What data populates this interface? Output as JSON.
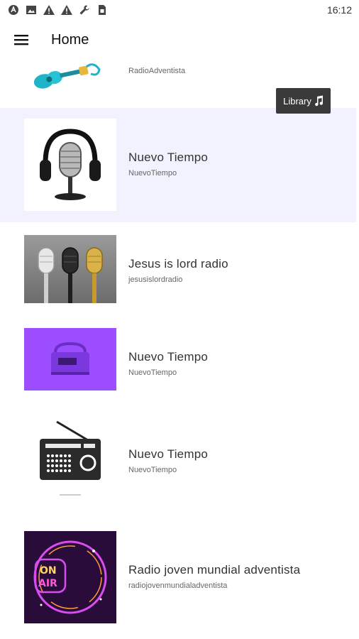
{
  "status_bar": {
    "time": "16:12",
    "icons": [
      "app-a-icon",
      "image-icon",
      "warning-icon",
      "warning-icon",
      "wrench-icon",
      "sim-icon"
    ]
  },
  "app_bar": {
    "title": "Home",
    "menu_icon": "hamburger-menu-icon"
  },
  "library_button": {
    "label": "Library",
    "icon": "music-note-icon"
  },
  "stations": [
    {
      "title": "",
      "subtitle": "RadioAdventista",
      "thumb": "guitar-image"
    },
    {
      "title": "Nuevo Tiempo",
      "subtitle": "NuevoTiempo",
      "thumb": "microphone-headphones-image",
      "selected": true
    },
    {
      "title": "Jesus is lord radio",
      "subtitle": "jesusislordradio",
      "thumb": "three-microphones-image"
    },
    {
      "title": "Nuevo Tiempo",
      "subtitle": "NuevoTiempo",
      "thumb": "purple-radio-image"
    },
    {
      "title": "Nuevo Tiempo",
      "subtitle": "NuevoTiempo",
      "thumb": "retro-radio-image"
    },
    {
      "title": "Radio joven mundial adventista",
      "subtitle": "radiojovenmundialadventista",
      "thumb": "on-air-neon-image"
    }
  ],
  "colors": {
    "selected_row": "#f1f2fd",
    "chip_bg": "#3a3a3a",
    "on_air_bg": "#2a0c3a",
    "purple_thumb": "#9b4dff"
  }
}
